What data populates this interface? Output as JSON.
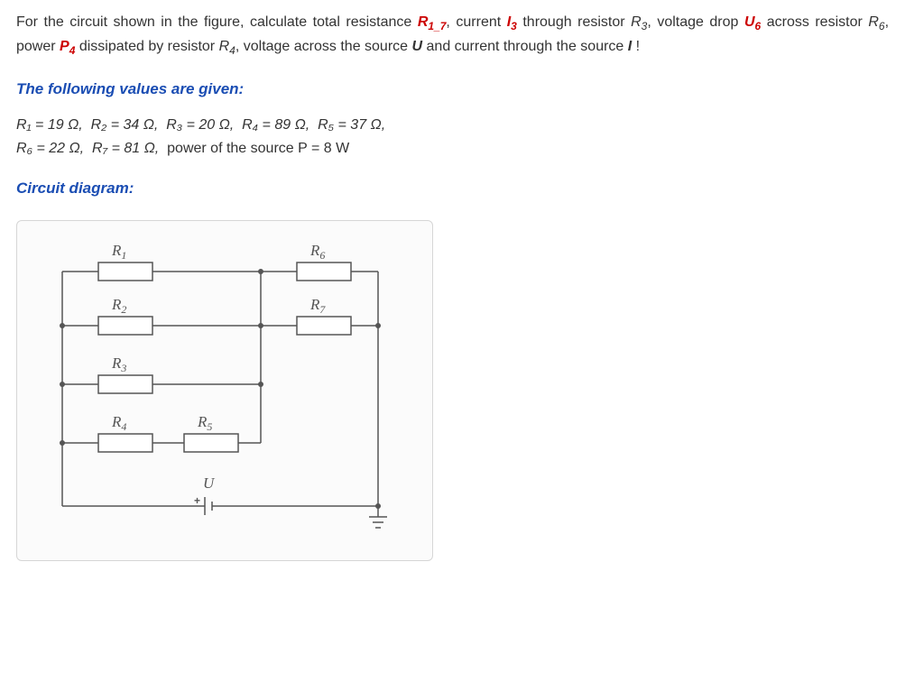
{
  "problem": {
    "prefix": "For the circuit shown in the figure, calculate total resistance ",
    "r17_sym": "R",
    "r17_sub": "1_7",
    "r17_suffix": ",",
    "mid1": " current ",
    "i3_sym": "I",
    "i3_sub": "3",
    "mid2": " through resistor ",
    "r3p_sym": "R",
    "r3p_sub": "3",
    "r3p_suffix": ",",
    "mid3": " voltage drop ",
    "u6_sym": "U",
    "u6_sub": "6",
    "mid4": " across resistor ",
    "r6p_sym": "R",
    "r6p_sub": "6",
    "r6p_suffix": ",",
    "mid5": " power ",
    "p4_sym": "P",
    "p4_sub": "4",
    "mid6": " dissipated by resistor ",
    "r4p_sym": "R",
    "r4p_sub": "4",
    "r4p_suffix": ",",
    "mid7": " voltage across the source ",
    "u_sym": "U",
    "mid8": " and current through the source ",
    "i_sym": "I",
    "end": " !"
  },
  "headings": {
    "given": "The following values are given:",
    "diagram": "Circuit diagram:"
  },
  "given": {
    "r1": "R₁ = 19 Ω,",
    "r2": "R₂ = 34 Ω,",
    "r3": "R₃ = 20 Ω,",
    "r4": "R₄ = 89 Ω,",
    "r5": "R₅ = 37 Ω,",
    "r6": "R₆ = 22 Ω,",
    "r7": "R₇ = 81 Ω,",
    "p": "power of the source P = 8 W"
  },
  "labels": {
    "R1": "R",
    "R1s": "1",
    "R2": "R",
    "R2s": "2",
    "R3": "R",
    "R3s": "3",
    "R4": "R",
    "R4s": "4",
    "R5": "R",
    "R5s": "5",
    "R6": "R",
    "R6s": "6",
    "R7": "R",
    "R7s": "7",
    "U": "U"
  }
}
